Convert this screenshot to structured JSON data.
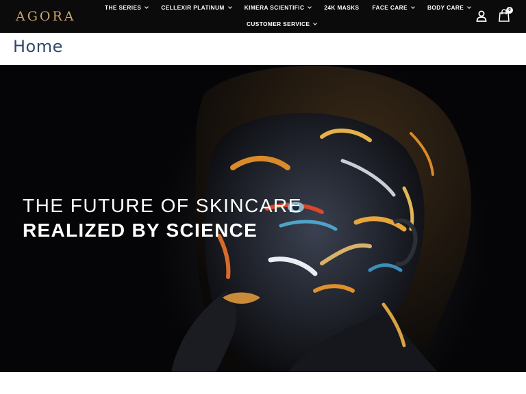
{
  "brand": {
    "logo_text": "AGORA",
    "accent": "#c9a46a"
  },
  "nav": {
    "row1": [
      {
        "label": "THE SERIES",
        "has_dropdown": true
      },
      {
        "label": "CELLEXIR PLATINUM",
        "has_dropdown": true
      },
      {
        "label": "KIMERA SCIENTIFIC",
        "has_dropdown": true
      },
      {
        "label": "24K MASKS",
        "has_dropdown": false
      },
      {
        "label": "FACE CARE",
        "has_dropdown": true
      },
      {
        "label": "BODY CARE",
        "has_dropdown": true
      }
    ],
    "row2": [
      {
        "label": "CUSTOMER SERVICE",
        "has_dropdown": true
      }
    ]
  },
  "header_actions": {
    "account_icon": "user-icon",
    "cart_icon": "cart-icon",
    "cart_count": "0"
  },
  "page": {
    "title": "Home",
    "title_color": "#2e4a6a"
  },
  "hero": {
    "line1": "THE FUTURE OF SKINCARE",
    "line2": "REALIZED BY SCIENCE",
    "background": "#0b0b0b"
  }
}
